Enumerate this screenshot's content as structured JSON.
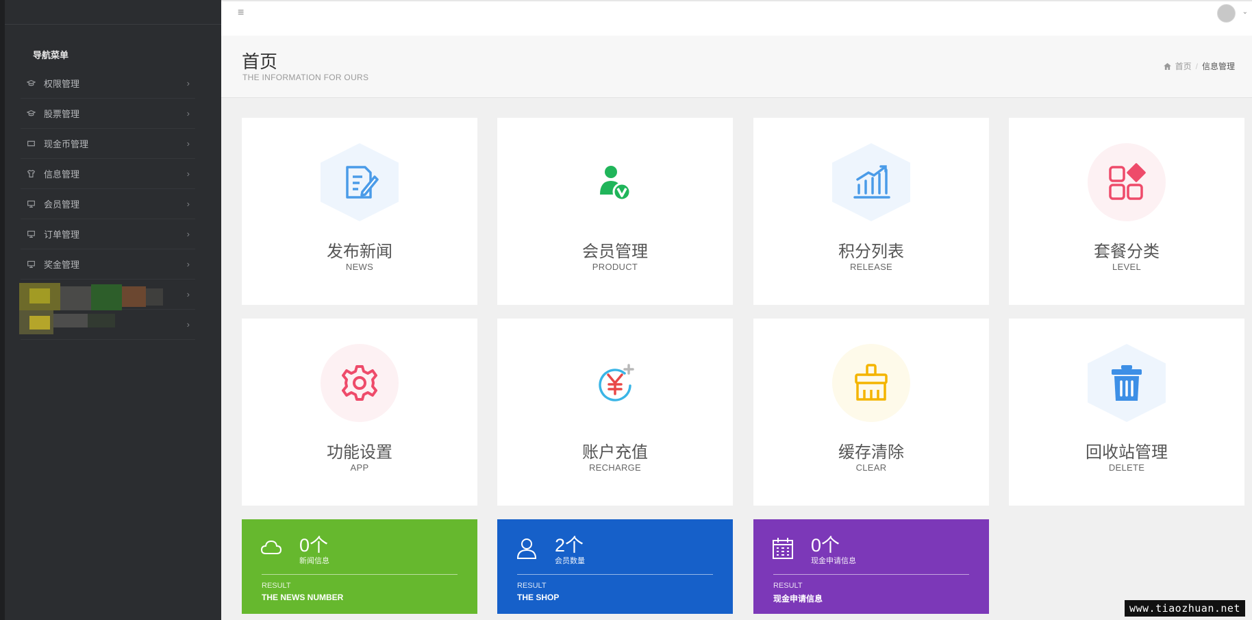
{
  "sidebar": {
    "nav_title": "导航菜单",
    "items": [
      {
        "label": "权限管理",
        "icon": "graduation-cap-icon"
      },
      {
        "label": "股票管理",
        "icon": "graduation-cap-icon"
      },
      {
        "label": "现金币管理",
        "icon": "ticket-icon"
      },
      {
        "label": "信息管理",
        "icon": "shirt-icon"
      },
      {
        "label": "会员管理",
        "icon": "monitor-icon"
      },
      {
        "label": "订单管理",
        "icon": "monitor-icon"
      },
      {
        "label": "奖金管理",
        "icon": "monitor-icon"
      }
    ],
    "chevron": "›"
  },
  "header": {
    "menu_icon": "≡",
    "avatar_caret": "⌄"
  },
  "page": {
    "title": "首页",
    "subtitle": "THE INFORMATION FOR OURS",
    "breadcrumb": {
      "home": "首页",
      "sep": "/",
      "current": "信息管理"
    }
  },
  "cards": [
    {
      "cn": "发布新闻",
      "en": "NEWS",
      "icon": "edit-document-icon",
      "color": "#4a9be8",
      "bg": "#eef5fd"
    },
    {
      "cn": "会员管理",
      "en": "PRODUCT",
      "icon": "verified-user-icon",
      "color": "#20b55a",
      "bg": "#ffffff"
    },
    {
      "cn": "积分列表",
      "en": "RELEASE",
      "icon": "bar-chart-icon",
      "color": "#4a9be8",
      "bg": "#eef5fd"
    },
    {
      "cn": "套餐分类",
      "en": "LEVEL",
      "icon": "category-grid-icon",
      "color": "#ee4b6a",
      "bg": "#fdf1f3"
    },
    {
      "cn": "功能设置",
      "en": "APP",
      "icon": "gear-icon",
      "color": "#ee4b6a",
      "bg": "#fdf1f3"
    },
    {
      "cn": "账户充值",
      "en": "RECHARGE",
      "icon": "yuan-recharge-icon",
      "color": "#e84848",
      "bg": "#ffffff"
    },
    {
      "cn": "缓存清除",
      "en": "CLEAR",
      "icon": "broom-icon",
      "color": "#f4b400",
      "bg": "#fefaea"
    },
    {
      "cn": "回收站管理",
      "en": "DELETE",
      "icon": "trash-icon",
      "color": "#3d8fe6",
      "bg": "#eef5fd"
    }
  ],
  "stats": [
    {
      "number": "0个",
      "label": "新闻信息",
      "result": "RESULT",
      "result_text": "THE NEWS NUMBER",
      "icon": "cloud-icon",
      "color": "#66b82e"
    },
    {
      "number": "2个",
      "label": "会员数量",
      "result": "RESULT",
      "result_text": "THE SHOP",
      "icon": "user-icon",
      "color": "#1660c9"
    },
    {
      "number": "0个",
      "label": "现金申请信息",
      "result": "RESULT",
      "result_text": "现金申请信息",
      "icon": "calendar-icon",
      "color": "#7c38b8"
    }
  ],
  "watermark": "www.tiaozhuan.net"
}
